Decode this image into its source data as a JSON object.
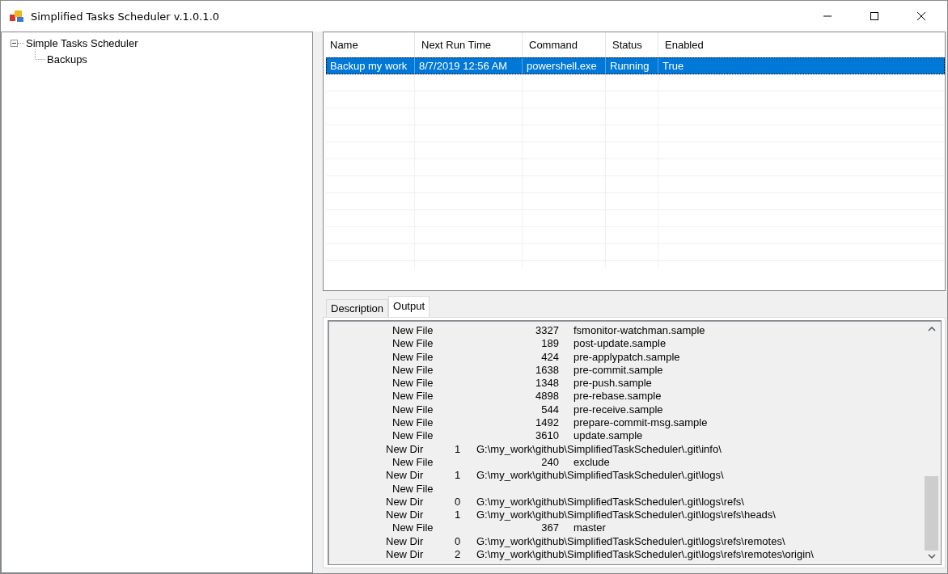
{
  "window": {
    "title": "Simplified Tasks Scheduler v.1.0.1.0"
  },
  "tree": [
    {
      "label": "Simple Tasks Scheduler",
      "expanded": true,
      "children": [
        {
          "label": "Backups"
        }
      ]
    }
  ],
  "table": {
    "columns": [
      "Name",
      "Next Run Time",
      "Command",
      "Status",
      "Enabled"
    ],
    "rows": [
      {
        "cells": [
          "Backup my work",
          "8/7/2019 12:56 AM",
          "powershell.exe",
          "Running",
          "True"
        ],
        "selected": true
      }
    ]
  },
  "tabs": [
    {
      "label": "Description",
      "selected": false
    },
    {
      "label": "Output",
      "selected": true
    }
  ],
  "output": [
    {
      "kind": "file",
      "action": "New File",
      "count": "3327",
      "path": "fsmonitor-watchman.sample"
    },
    {
      "kind": "file",
      "action": "New File",
      "count": "189",
      "path": "post-update.sample"
    },
    {
      "kind": "file",
      "action": "New File",
      "count": "424",
      "path": "pre-applypatch.sample"
    },
    {
      "kind": "file",
      "action": "New File",
      "count": "1638",
      "path": "pre-commit.sample"
    },
    {
      "kind": "file",
      "action": "New File",
      "count": "1348",
      "path": "pre-push.sample"
    },
    {
      "kind": "file",
      "action": "New File",
      "count": "4898",
      "path": "pre-rebase.sample"
    },
    {
      "kind": "file",
      "action": "New File",
      "count": "544",
      "path": "pre-receive.sample"
    },
    {
      "kind": "file",
      "action": "New File",
      "count": "1492",
      "path": "prepare-commit-msg.sample"
    },
    {
      "kind": "file",
      "action": "New File",
      "count": "3610",
      "path": "update.sample"
    },
    {
      "kind": "dir",
      "action": "New Dir",
      "count": "1",
      "path": "G:\\my_work\\github\\SimplifiedTaskScheduler\\.git\\info\\"
    },
    {
      "kind": "file",
      "action": "New File",
      "count": "240",
      "path": "exclude"
    },
    {
      "kind": "dir",
      "action": "New Dir",
      "count": "1",
      "path": "G:\\my_work\\github\\SimplifiedTaskScheduler\\.git\\logs\\"
    },
    {
      "kind": "file",
      "action": "New File"
    },
    {
      "kind": "dir",
      "action": "New Dir",
      "count": "0",
      "path": "G:\\my_work\\github\\SimplifiedTaskScheduler\\.git\\logs\\refs\\"
    },
    {
      "kind": "dir",
      "action": "New Dir",
      "count": "1",
      "path": "G:\\my_work\\github\\SimplifiedTaskScheduler\\.git\\logs\\refs\\heads\\"
    },
    {
      "kind": "file",
      "action": "New File",
      "count": "367",
      "path": "master"
    },
    {
      "kind": "dir",
      "action": "New Dir",
      "count": "0",
      "path": "G:\\my_work\\github\\SimplifiedTaskScheduler\\.git\\logs\\refs\\remotes\\"
    },
    {
      "kind": "dir",
      "action": "New Dir",
      "count": "2",
      "path": "G:\\my_work\\github\\SimplifiedTaskScheduler\\.git\\logs\\refs\\remotes\\origin\\"
    }
  ]
}
